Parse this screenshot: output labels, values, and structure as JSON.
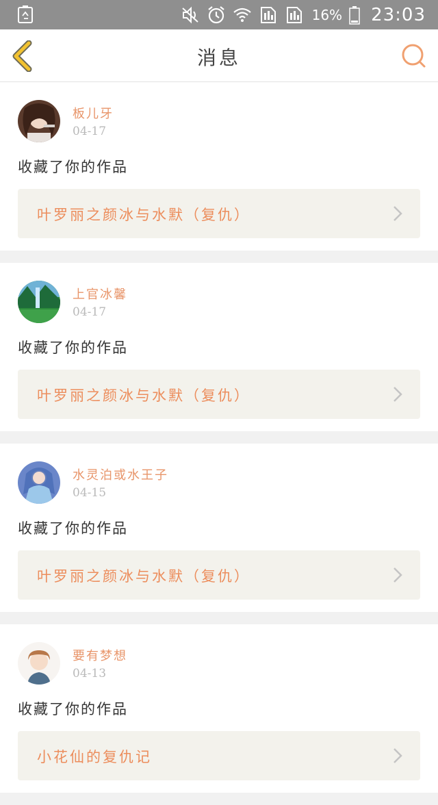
{
  "status_bar": {
    "battery_percent": "16%",
    "time": "23:03"
  },
  "header": {
    "title": "消息"
  },
  "messages": [
    {
      "user": "板儿牙",
      "date": "04-17",
      "action": "收藏了你的作品",
      "work": "叶罗丽之颜冰与水默（复仇）"
    },
    {
      "user": "上官冰馨",
      "date": "04-17",
      "action": "收藏了你的作品",
      "work": "叶罗丽之颜冰与水默（复仇）"
    },
    {
      "user": "水灵泊或水王子",
      "date": "04-15",
      "action": "收藏了你的作品",
      "work": "叶罗丽之颜冰与水默（复仇）"
    },
    {
      "user": "要有梦想",
      "date": "04-13",
      "action": "收藏了你的作品",
      "work": "小花仙的复仇记"
    }
  ],
  "colors": {
    "accent": "#e8956a",
    "back_icon": "#f2c230",
    "search_icon": "#f0a070"
  }
}
